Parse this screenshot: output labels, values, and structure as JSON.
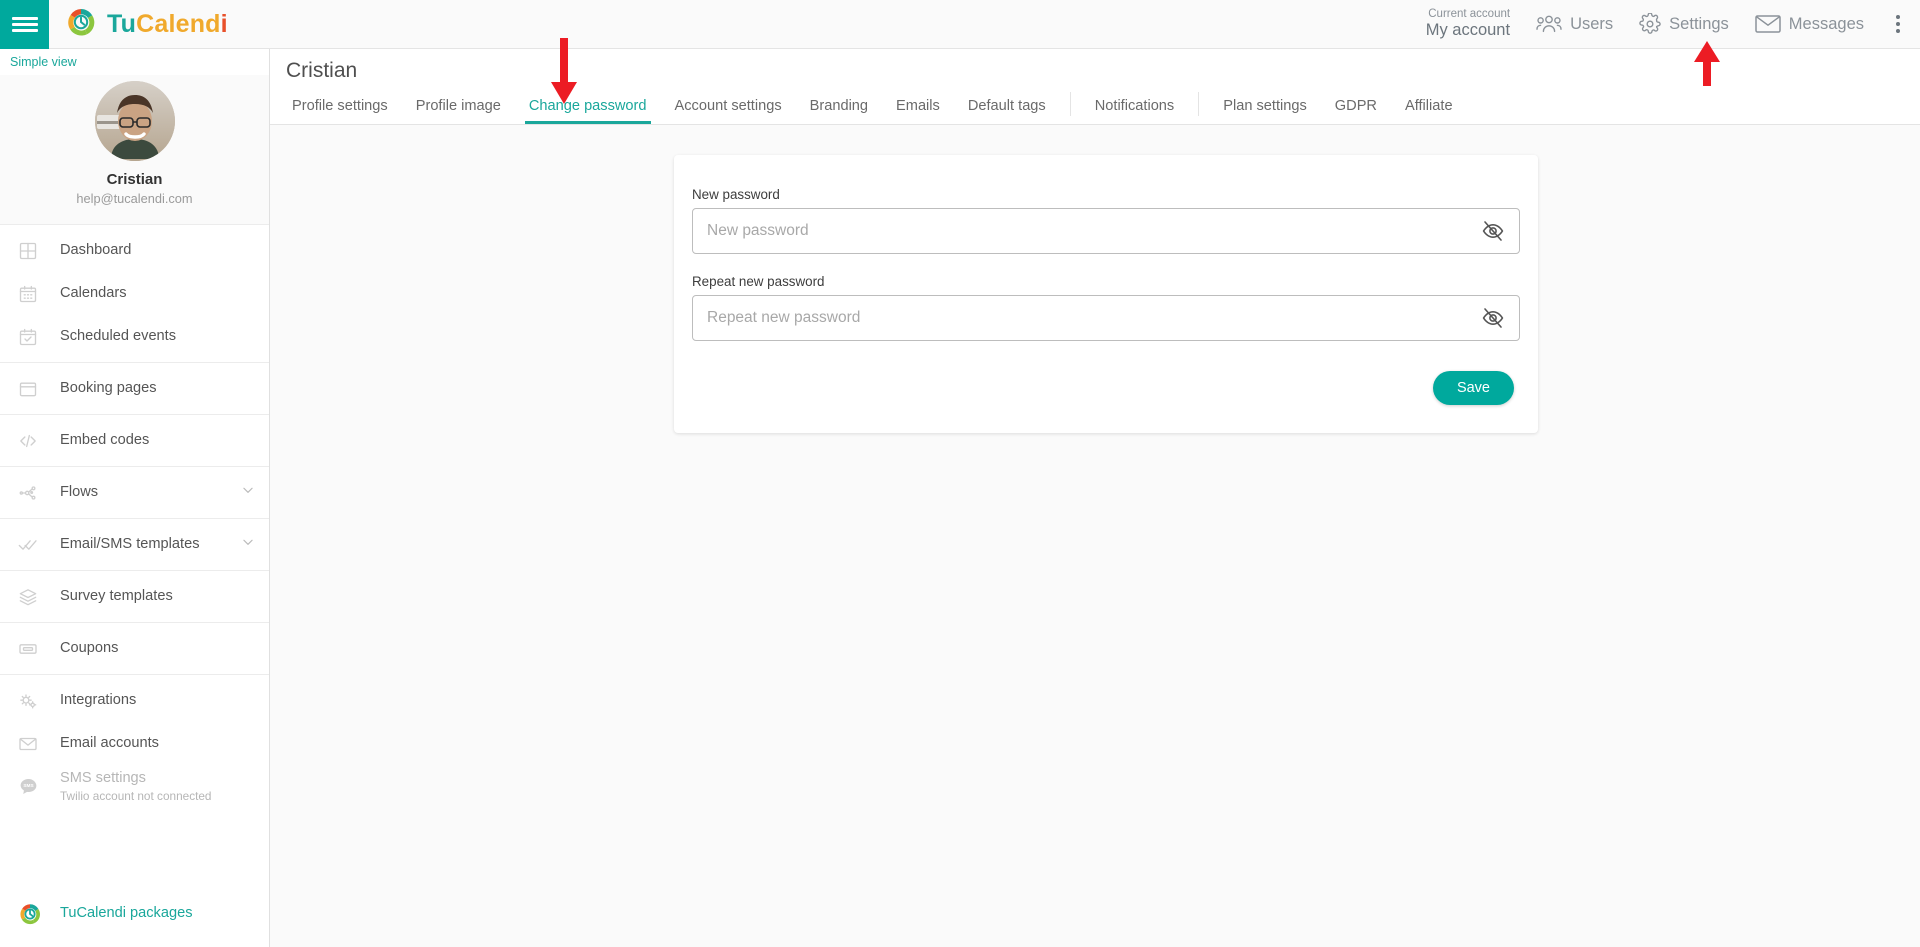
{
  "topbar": {
    "menu_icon": "hamburger-icon",
    "logo_icon": "tucalendi-logo-icon",
    "brand": {
      "part1": "Tu",
      "part2": "Calend",
      "part3": "i"
    },
    "account": {
      "label": "Current account",
      "value": "My account"
    },
    "items": [
      {
        "icon": "users-icon",
        "label": "Users"
      },
      {
        "icon": "gear-icon",
        "label": "Settings"
      },
      {
        "icon": "envelope-icon",
        "label": "Messages"
      }
    ],
    "overflow_icon": "kebab-menu-icon"
  },
  "sidebar": {
    "simple_view": "Simple view",
    "profile": {
      "name": "Cristian",
      "email": "help@tucalendi.com",
      "avatar": "user-avatar"
    },
    "items": [
      {
        "icon": "dashboard-icon",
        "label": "Dashboard",
        "chevron": false,
        "divider_after": false,
        "disabled": false
      },
      {
        "icon": "calendar-icon",
        "label": "Calendars",
        "chevron": false,
        "divider_after": false,
        "disabled": false
      },
      {
        "icon": "calendar-check-icon",
        "label": "Scheduled events",
        "chevron": false,
        "divider_after": true,
        "disabled": false
      },
      {
        "icon": "browser-window-icon",
        "label": "Booking pages",
        "chevron": false,
        "divider_after": true,
        "disabled": false
      },
      {
        "icon": "code-icon",
        "label": "Embed codes",
        "chevron": false,
        "divider_after": true,
        "disabled": false
      },
      {
        "icon": "flow-nodes-icon",
        "label": "Flows",
        "chevron": true,
        "divider_after": true,
        "disabled": false
      },
      {
        "icon": "double-check-icon",
        "label": "Email/SMS templates",
        "chevron": true,
        "divider_after": true,
        "disabled": false
      },
      {
        "icon": "layers-icon",
        "label": "Survey templates",
        "chevron": false,
        "divider_after": true,
        "disabled": false
      },
      {
        "icon": "coupon-ticket-icon",
        "label": "Coupons",
        "chevron": false,
        "divider_after": true,
        "disabled": false
      },
      {
        "icon": "gears-icon",
        "label": "Integrations",
        "chevron": false,
        "divider_after": false,
        "disabled": false
      },
      {
        "icon": "envelope-icon",
        "label": "Email accounts",
        "chevron": false,
        "divider_after": false,
        "disabled": false
      },
      {
        "icon": "sms-bubble-icon",
        "label": "SMS settings",
        "sublabel": "Twilio account not connected",
        "chevron": false,
        "divider_after": false,
        "disabled": true
      }
    ],
    "packages": {
      "icon": "tucalendi-logo-icon",
      "label": "TuCalendi packages"
    }
  },
  "page": {
    "title": "Cristian",
    "tabs": [
      {
        "label": "Profile settings",
        "active": false,
        "sep_after": false
      },
      {
        "label": "Profile image",
        "active": false,
        "sep_after": false
      },
      {
        "label": "Change password",
        "active": true,
        "sep_after": false
      },
      {
        "label": "Account settings",
        "active": false,
        "sep_after": false
      },
      {
        "label": "Branding",
        "active": false,
        "sep_after": false
      },
      {
        "label": "Emails",
        "active": false,
        "sep_after": false
      },
      {
        "label": "Default tags",
        "active": false,
        "sep_after": true
      },
      {
        "label": "Notifications",
        "active": false,
        "sep_after": true
      },
      {
        "label": "Plan settings",
        "active": false,
        "sep_after": false
      },
      {
        "label": "GDPR",
        "active": false,
        "sep_after": false
      },
      {
        "label": "Affiliate",
        "active": false,
        "sep_after": false
      }
    ]
  },
  "form": {
    "new_password": {
      "label": "New password",
      "placeholder": "New password",
      "value": "",
      "toggle_icon": "eye-slash-icon"
    },
    "repeat_password": {
      "label": "Repeat new password",
      "placeholder": "Repeat new password",
      "value": "",
      "toggle_icon": "eye-slash-icon"
    },
    "save_label": "Save"
  },
  "annotations": [
    {
      "name": "arrow-pointing-to-change-password-tab",
      "direction": "down",
      "color": "#ec1c24"
    },
    {
      "name": "arrow-pointing-to-settings-menu",
      "direction": "up",
      "color": "#ec1c24"
    }
  ],
  "colors": {
    "accent_teal": "#00a99d",
    "brand_orange": "#f0a92c",
    "brand_red": "#e8502a",
    "annotation_red": "#ec1c24"
  }
}
